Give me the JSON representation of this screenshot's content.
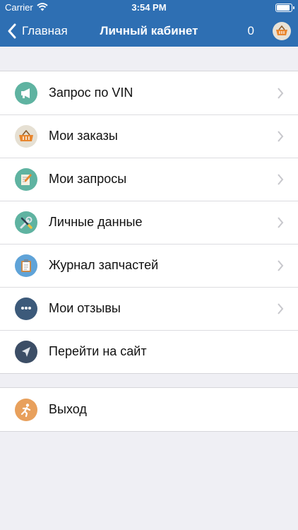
{
  "status": {
    "carrier": "Carrier",
    "time": "3:54 PM"
  },
  "nav": {
    "back_label": "Главная",
    "title": "Личный кабинет",
    "cart_count": "0"
  },
  "menu": [
    {
      "label": "Запрос по VIN",
      "icon": "megaphone-icon",
      "color": "#5fb3a1",
      "chevron": true
    },
    {
      "label": "Мои заказы",
      "icon": "basket-icon",
      "color": "#e6e0d3",
      "chevron": true
    },
    {
      "label": "Мои запросы",
      "icon": "notepad-pencil-icon",
      "color": "#5fb3a1",
      "chevron": true
    },
    {
      "label": "Личные данные",
      "icon": "wrench-screwdriver-icon",
      "color": "#5fb3a1",
      "chevron": true
    },
    {
      "label": "Журнал запчастей",
      "icon": "clipboard-icon",
      "color": "#5fa3d8",
      "chevron": true
    },
    {
      "label": "Мои отзывы",
      "icon": "speech-bubble-icon",
      "color": "#3c5a7a",
      "chevron": true
    },
    {
      "label": "Перейти на сайт",
      "icon": "cursor-arrow-icon",
      "color": "#3c4e66",
      "chevron": false
    }
  ],
  "logout": {
    "label": "Выход",
    "icon": "running-man-icon",
    "color": "#e8a05c"
  }
}
